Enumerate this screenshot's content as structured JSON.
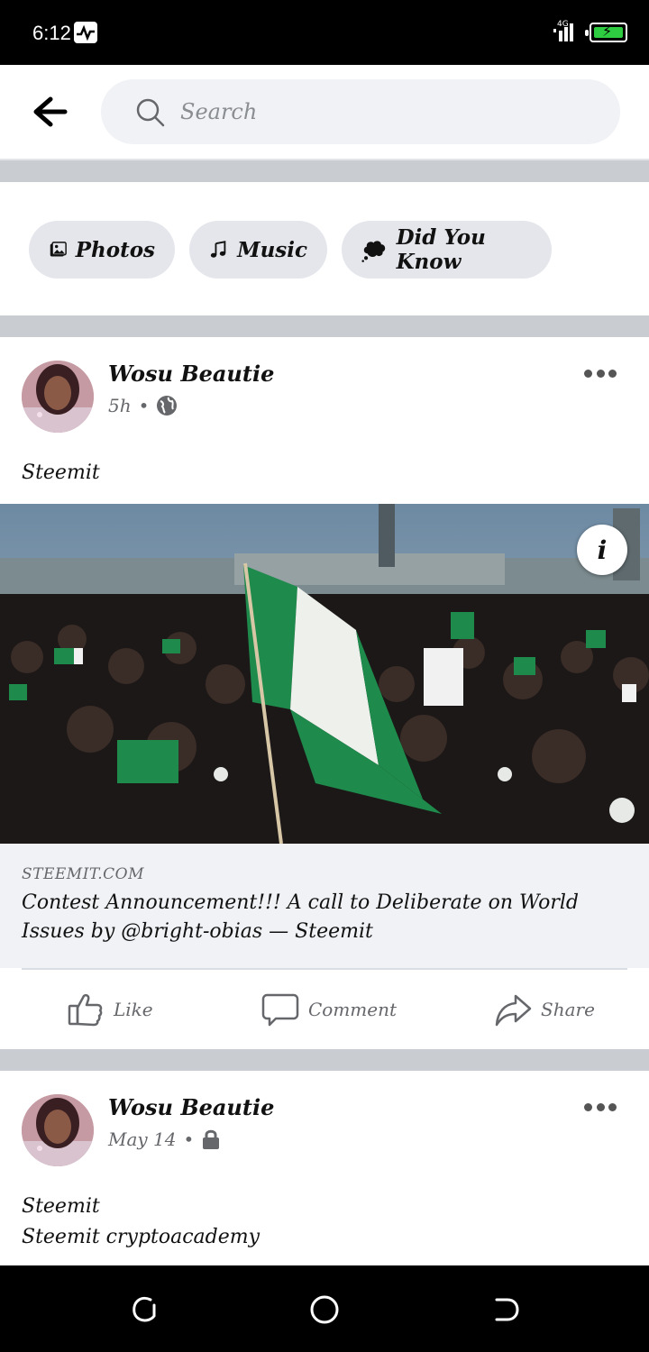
{
  "status_bar": {
    "time": "6:12",
    "network": "4G"
  },
  "search": {
    "placeholder": "Search"
  },
  "chips": [
    {
      "label": "Photos",
      "icon": "photos-icon"
    },
    {
      "label": "Music",
      "icon": "music-note-icon"
    },
    {
      "label": "Did You Know",
      "icon": "thought-bubble-icon"
    }
  ],
  "posts": [
    {
      "author": "Wosu Beautie",
      "time": "5h",
      "privacy": "globe-icon",
      "text": "Steemit",
      "link": {
        "domain": "STEEMIT.COM",
        "title": "Contest Announcement!!! A call to Deliberate on World Issues by @bright-obias — Steemit"
      },
      "actions": {
        "like": "Like",
        "comment": "Comment",
        "share": "Share"
      }
    },
    {
      "author": "Wosu Beautie",
      "time": "May 14",
      "privacy": "lock-icon",
      "text_line1": "Steemit",
      "text_line2": "Steemit cryptoacademy"
    }
  ],
  "colors": {
    "chip_bg": "#e4e6eb",
    "search_bg": "#f0f2f5",
    "divider": "#c9ccd1",
    "flag_green": "#1e8a4c"
  }
}
